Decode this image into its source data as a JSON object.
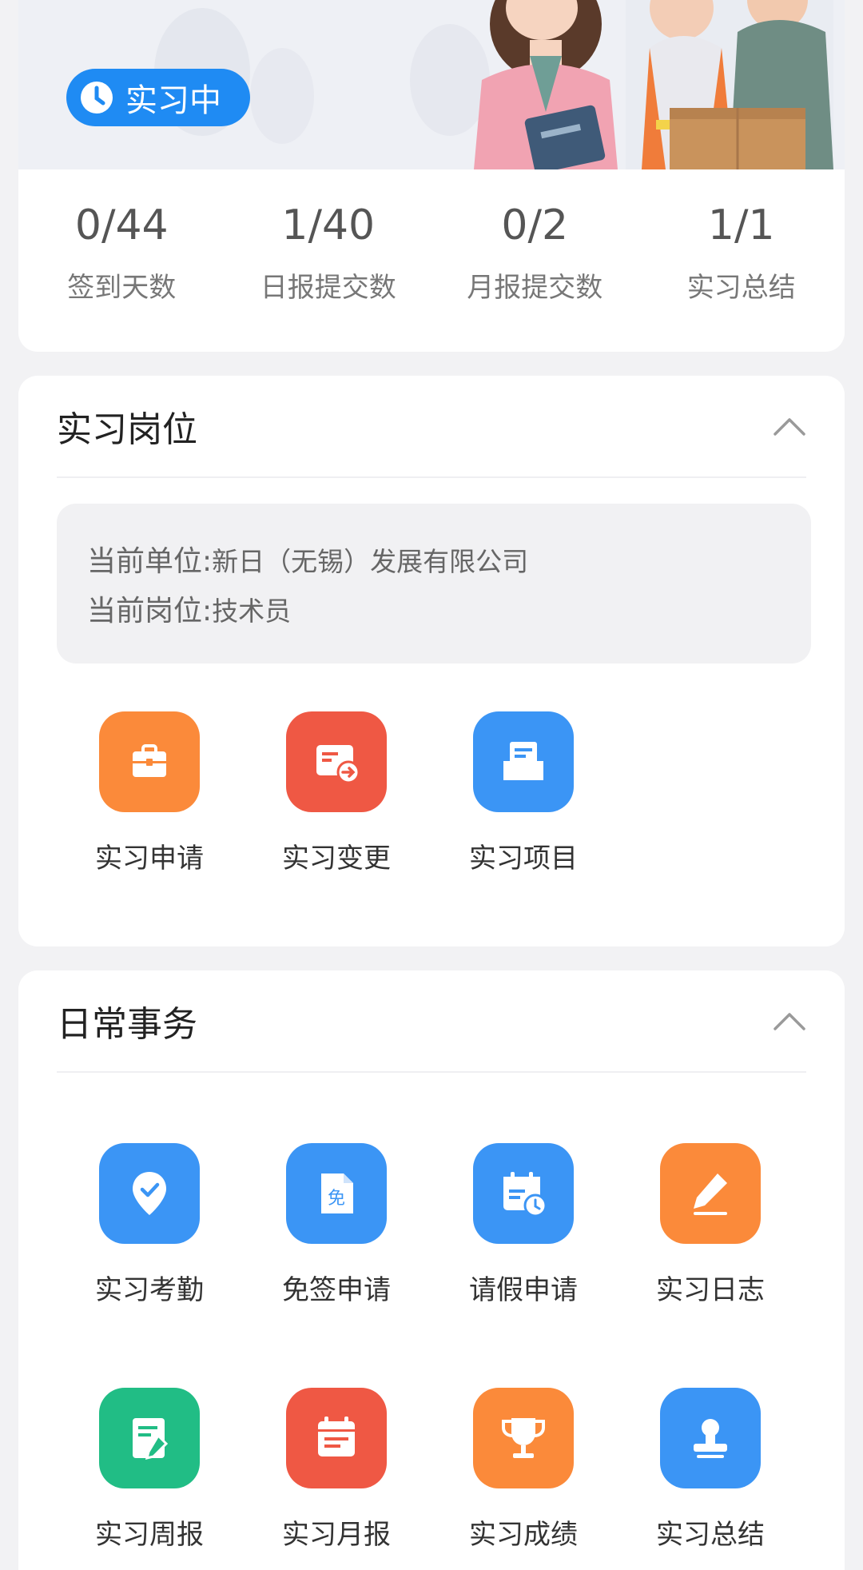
{
  "status": {
    "label": "实习中",
    "stats": [
      {
        "value": "0/44",
        "label": "签到天数"
      },
      {
        "value": "1/40",
        "label": "日报提交数"
      },
      {
        "value": "0/2",
        "label": "月报提交数"
      },
      {
        "value": "1/1",
        "label": "实习总结"
      }
    ]
  },
  "position_section": {
    "title": "实习岗位",
    "unit_key": "当前单位:",
    "unit_value": "新日（无锡）发展有限公司",
    "post_key": "当前岗位:",
    "post_value": "技术员",
    "actions": [
      {
        "label": "实习申请",
        "icon": "briefcase-icon",
        "color": "#fb8a3a"
      },
      {
        "label": "实习变更",
        "icon": "card-transfer-icon",
        "color": "#ef5844"
      },
      {
        "label": "实习项目",
        "icon": "inbox-document-icon",
        "color": "#3b95f5"
      }
    ]
  },
  "daily_section": {
    "title": "日常事务",
    "actions": [
      {
        "label": "实习考勤",
        "icon": "location-check-icon",
        "color": "#3b95f5"
      },
      {
        "label": "免签申请",
        "icon": "exempt-document-icon",
        "color": "#3b95f5",
        "glyph": "免"
      },
      {
        "label": "请假申请",
        "icon": "calendar-clock-icon",
        "color": "#3b95f5"
      },
      {
        "label": "实习日志",
        "icon": "pencil-icon",
        "color": "#fb8a3a"
      },
      {
        "label": "实习周报",
        "icon": "edit-document-icon",
        "color": "#21bd85"
      },
      {
        "label": "实习月报",
        "icon": "calendar-report-icon",
        "color": "#ef5844"
      },
      {
        "label": "实习成绩",
        "icon": "trophy-icon",
        "color": "#fb8a3a"
      },
      {
        "label": "实习总结",
        "icon": "stamp-icon",
        "color": "#3b95f5"
      }
    ]
  }
}
